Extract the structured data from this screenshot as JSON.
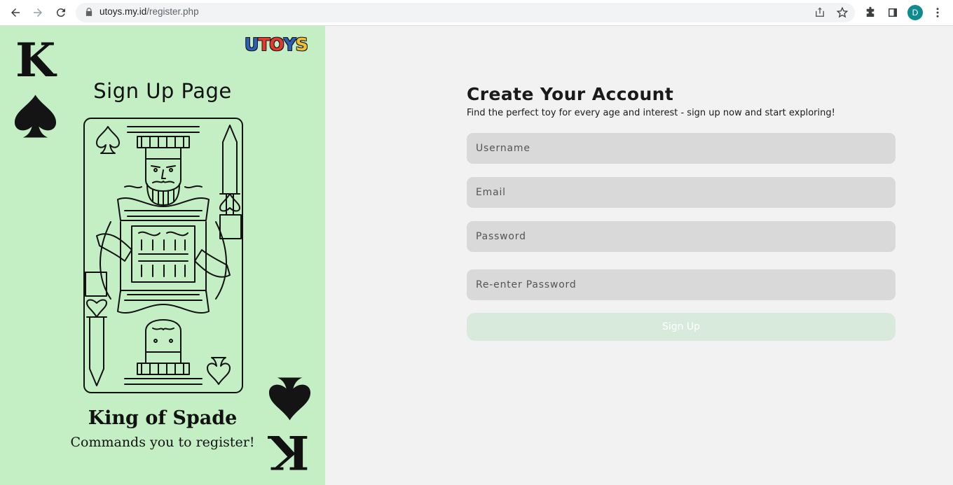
{
  "browser": {
    "url_domain": "utoys.my.id",
    "url_path": "/register.php",
    "profile_initial": "D"
  },
  "left_panel": {
    "logo_text": [
      "U",
      "T",
      "O",
      "Y",
      "S"
    ],
    "logo_colors": [
      "#2c5fb8",
      "#e23b2e",
      "#e23b2e",
      "#2c5fb8",
      "#f2c12e"
    ],
    "card_rank": "K",
    "page_title": "Sign Up Page",
    "king_title": "King of Spade",
    "king_subtitle": "Commands you to register!",
    "background": "#c4efc4"
  },
  "form": {
    "title": "Create Your Account",
    "subtitle": "Find the perfect toy for every age and interest - sign up now and start exploring!",
    "username_placeholder": "Username",
    "email_placeholder": "Email",
    "password_placeholder": "Password",
    "repassword_placeholder": "Re-enter Password",
    "submit_label": "Sign Up",
    "field_color": "#d9d9d9",
    "button_color": "#d7eadb"
  }
}
